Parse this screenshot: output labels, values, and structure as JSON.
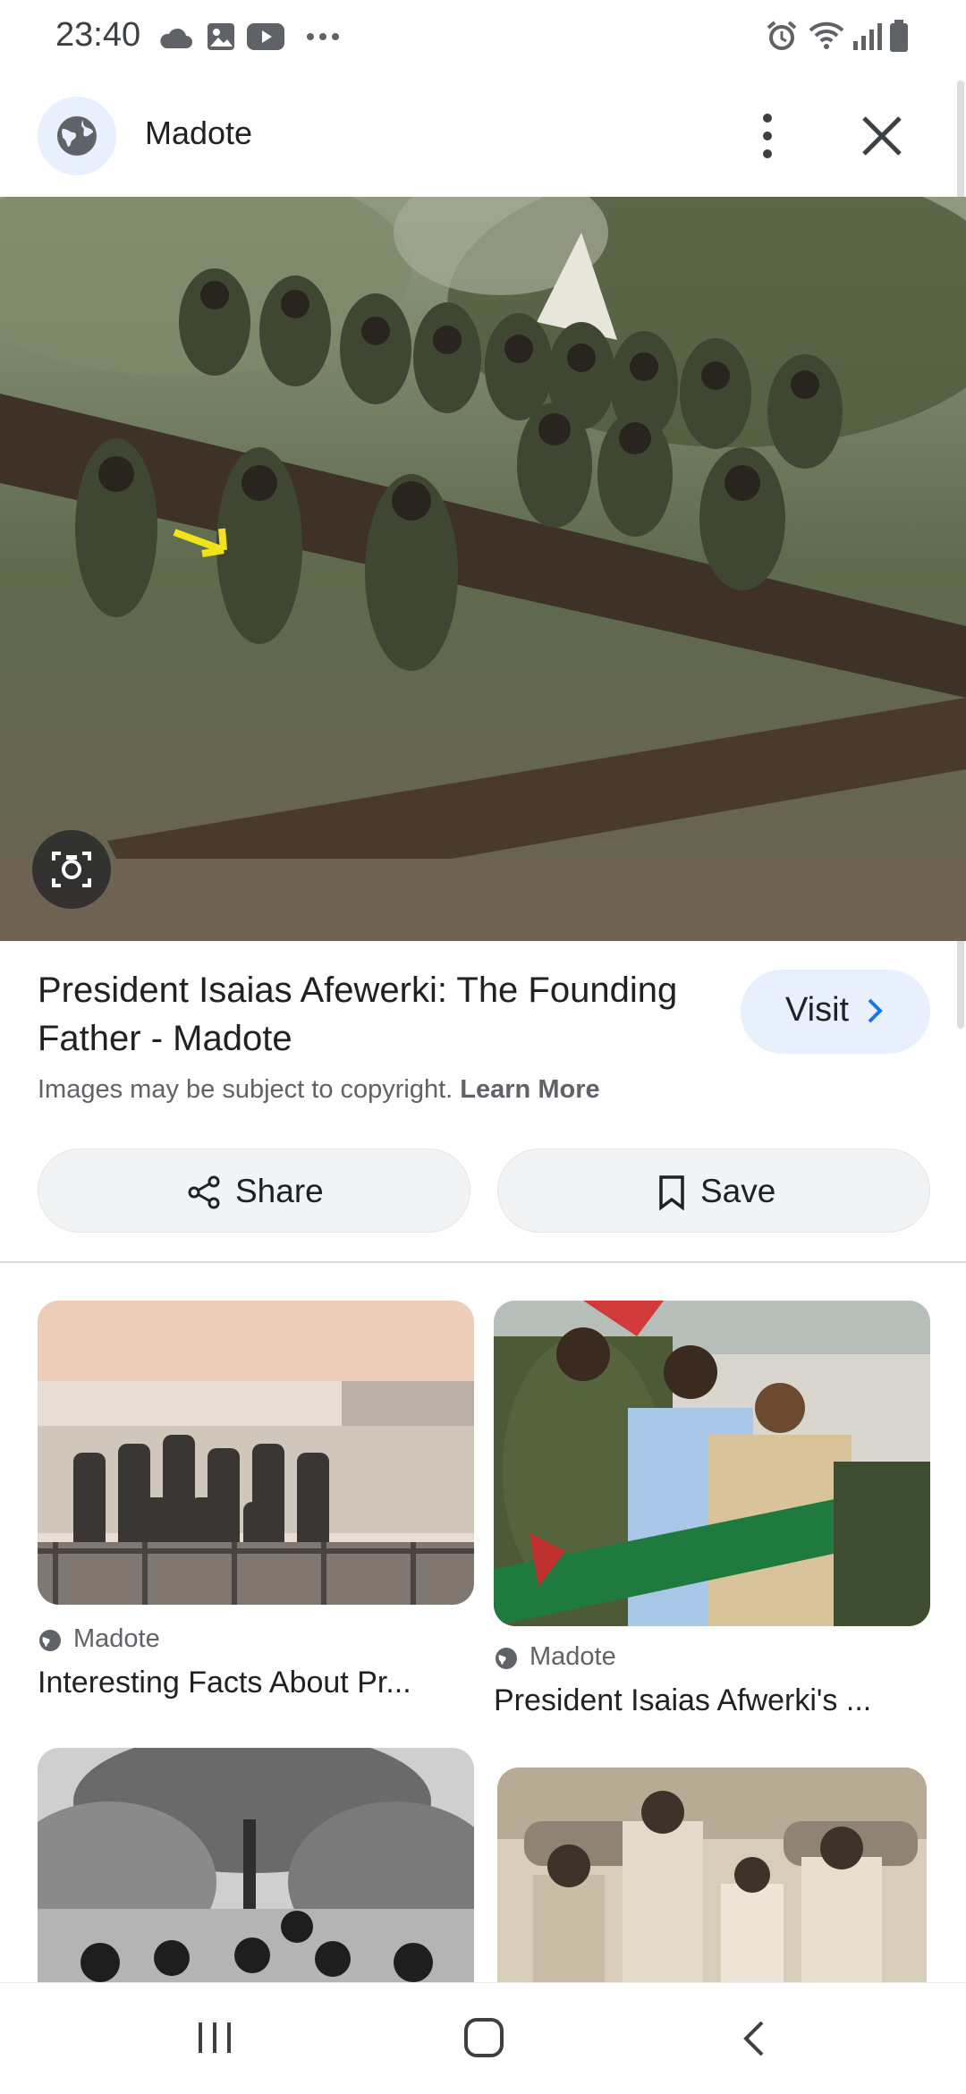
{
  "status_bar": {
    "time": "23:40"
  },
  "header": {
    "site_name": "Madote",
    "menu_icon": "more-vert-icon",
    "close_icon": "close-icon"
  },
  "result": {
    "title": "President Isaias Afewerki: The Founding Father - Madote",
    "visit_label": "Visit",
    "copyright_text": "Images may be subject to copyright.",
    "learn_more": "Learn More",
    "share_label": "Share",
    "save_label": "Save"
  },
  "related": [
    {
      "source": "Madote",
      "title": "Interesting Facts About Pr..."
    },
    {
      "source": "Madote",
      "title": "President Isaias Afwerki's ..."
    }
  ],
  "colors": {
    "accent_bg": "#e8f0fe",
    "pill_bg": "#f1f3f4",
    "link_blue": "#1a73e8",
    "secondary_text": "#5f6368"
  }
}
